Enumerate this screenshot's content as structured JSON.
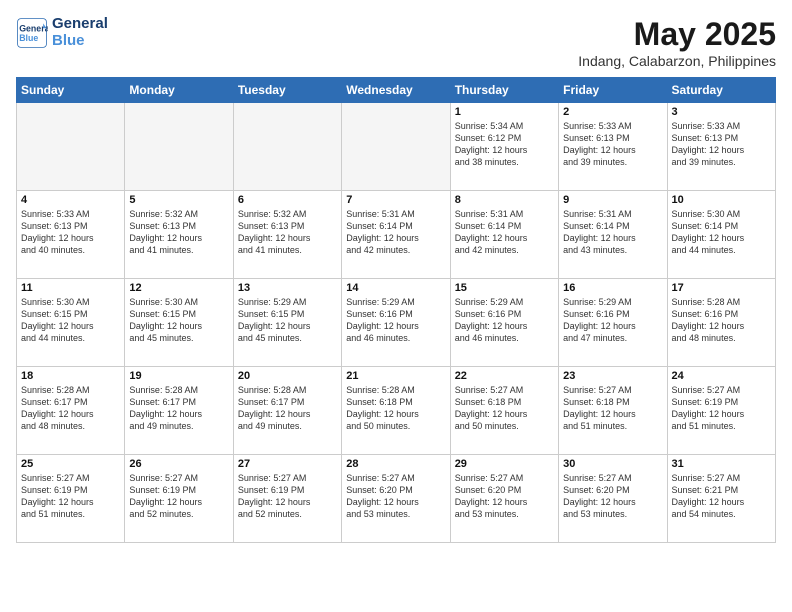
{
  "logo": {
    "line1": "General",
    "line2": "Blue"
  },
  "title": "May 2025",
  "subtitle": "Indang, Calabarzon, Philippines",
  "days_header": [
    "Sunday",
    "Monday",
    "Tuesday",
    "Wednesday",
    "Thursday",
    "Friday",
    "Saturday"
  ],
  "weeks": [
    [
      {
        "num": "",
        "info": "",
        "empty": true
      },
      {
        "num": "",
        "info": "",
        "empty": true
      },
      {
        "num": "",
        "info": "",
        "empty": true
      },
      {
        "num": "",
        "info": "",
        "empty": true
      },
      {
        "num": "1",
        "info": "Sunrise: 5:34 AM\nSunset: 6:12 PM\nDaylight: 12 hours\nand 38 minutes."
      },
      {
        "num": "2",
        "info": "Sunrise: 5:33 AM\nSunset: 6:13 PM\nDaylight: 12 hours\nand 39 minutes."
      },
      {
        "num": "3",
        "info": "Sunrise: 5:33 AM\nSunset: 6:13 PM\nDaylight: 12 hours\nand 39 minutes."
      }
    ],
    [
      {
        "num": "4",
        "info": "Sunrise: 5:33 AM\nSunset: 6:13 PM\nDaylight: 12 hours\nand 40 minutes."
      },
      {
        "num": "5",
        "info": "Sunrise: 5:32 AM\nSunset: 6:13 PM\nDaylight: 12 hours\nand 41 minutes."
      },
      {
        "num": "6",
        "info": "Sunrise: 5:32 AM\nSunset: 6:13 PM\nDaylight: 12 hours\nand 41 minutes."
      },
      {
        "num": "7",
        "info": "Sunrise: 5:31 AM\nSunset: 6:14 PM\nDaylight: 12 hours\nand 42 minutes."
      },
      {
        "num": "8",
        "info": "Sunrise: 5:31 AM\nSunset: 6:14 PM\nDaylight: 12 hours\nand 42 minutes."
      },
      {
        "num": "9",
        "info": "Sunrise: 5:31 AM\nSunset: 6:14 PM\nDaylight: 12 hours\nand 43 minutes."
      },
      {
        "num": "10",
        "info": "Sunrise: 5:30 AM\nSunset: 6:14 PM\nDaylight: 12 hours\nand 44 minutes."
      }
    ],
    [
      {
        "num": "11",
        "info": "Sunrise: 5:30 AM\nSunset: 6:15 PM\nDaylight: 12 hours\nand 44 minutes."
      },
      {
        "num": "12",
        "info": "Sunrise: 5:30 AM\nSunset: 6:15 PM\nDaylight: 12 hours\nand 45 minutes."
      },
      {
        "num": "13",
        "info": "Sunrise: 5:29 AM\nSunset: 6:15 PM\nDaylight: 12 hours\nand 45 minutes."
      },
      {
        "num": "14",
        "info": "Sunrise: 5:29 AM\nSunset: 6:16 PM\nDaylight: 12 hours\nand 46 minutes."
      },
      {
        "num": "15",
        "info": "Sunrise: 5:29 AM\nSunset: 6:16 PM\nDaylight: 12 hours\nand 46 minutes."
      },
      {
        "num": "16",
        "info": "Sunrise: 5:29 AM\nSunset: 6:16 PM\nDaylight: 12 hours\nand 47 minutes."
      },
      {
        "num": "17",
        "info": "Sunrise: 5:28 AM\nSunset: 6:16 PM\nDaylight: 12 hours\nand 48 minutes."
      }
    ],
    [
      {
        "num": "18",
        "info": "Sunrise: 5:28 AM\nSunset: 6:17 PM\nDaylight: 12 hours\nand 48 minutes."
      },
      {
        "num": "19",
        "info": "Sunrise: 5:28 AM\nSunset: 6:17 PM\nDaylight: 12 hours\nand 49 minutes."
      },
      {
        "num": "20",
        "info": "Sunrise: 5:28 AM\nSunset: 6:17 PM\nDaylight: 12 hours\nand 49 minutes."
      },
      {
        "num": "21",
        "info": "Sunrise: 5:28 AM\nSunset: 6:18 PM\nDaylight: 12 hours\nand 50 minutes."
      },
      {
        "num": "22",
        "info": "Sunrise: 5:27 AM\nSunset: 6:18 PM\nDaylight: 12 hours\nand 50 minutes."
      },
      {
        "num": "23",
        "info": "Sunrise: 5:27 AM\nSunset: 6:18 PM\nDaylight: 12 hours\nand 51 minutes."
      },
      {
        "num": "24",
        "info": "Sunrise: 5:27 AM\nSunset: 6:19 PM\nDaylight: 12 hours\nand 51 minutes."
      }
    ],
    [
      {
        "num": "25",
        "info": "Sunrise: 5:27 AM\nSunset: 6:19 PM\nDaylight: 12 hours\nand 51 minutes."
      },
      {
        "num": "26",
        "info": "Sunrise: 5:27 AM\nSunset: 6:19 PM\nDaylight: 12 hours\nand 52 minutes."
      },
      {
        "num": "27",
        "info": "Sunrise: 5:27 AM\nSunset: 6:19 PM\nDaylight: 12 hours\nand 52 minutes."
      },
      {
        "num": "28",
        "info": "Sunrise: 5:27 AM\nSunset: 6:20 PM\nDaylight: 12 hours\nand 53 minutes."
      },
      {
        "num": "29",
        "info": "Sunrise: 5:27 AM\nSunset: 6:20 PM\nDaylight: 12 hours\nand 53 minutes."
      },
      {
        "num": "30",
        "info": "Sunrise: 5:27 AM\nSunset: 6:20 PM\nDaylight: 12 hours\nand 53 minutes."
      },
      {
        "num": "31",
        "info": "Sunrise: 5:27 AM\nSunset: 6:21 PM\nDaylight: 12 hours\nand 54 minutes."
      }
    ]
  ]
}
